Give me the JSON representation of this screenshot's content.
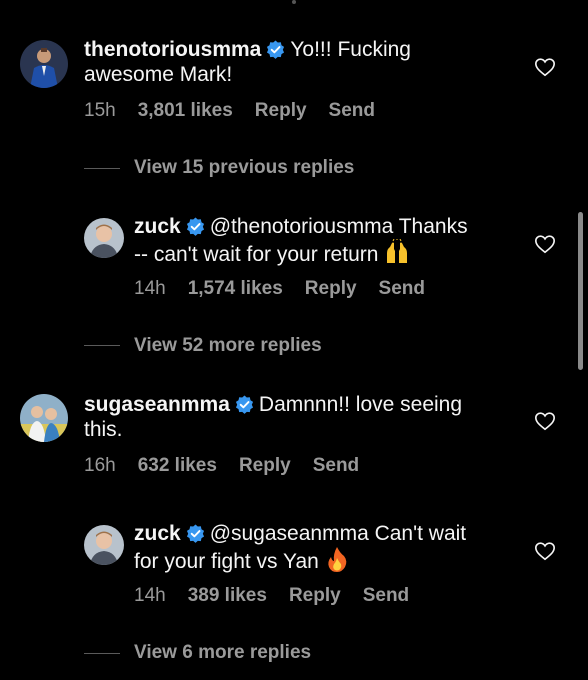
{
  "comments": [
    {
      "username": "thenotoriousmma",
      "text": "Yo!!! Fucking",
      "text2": "awesome Mark!",
      "time": "15h",
      "likes": "3,801 likes",
      "reply": "Reply",
      "send": "Send"
    },
    {
      "username": "zuck",
      "text": "@thenotoriousmma Thanks",
      "text2": "-- can't wait for your return",
      "time": "14h",
      "likes": "1,574 likes",
      "reply": "Reply",
      "send": "Send",
      "emoji": "raising-hands-emoji"
    },
    {
      "username": "sugaseanmma",
      "text": "Damnnn!! love seeing",
      "text2": "this.",
      "time": "16h",
      "likes": "632 likes",
      "reply": "Reply",
      "send": "Send"
    },
    {
      "username": "zuck",
      "text": "@sugaseanmma Can't wait",
      "text2": "for your fight vs Yan",
      "time": "14h",
      "likes": "389 likes",
      "reply": "Reply",
      "send": "Send",
      "emoji": "fire-emoji"
    }
  ],
  "view_links": [
    "View 15 previous replies",
    "View 52 more replies",
    "View 6 more replies"
  ],
  "colors": {
    "background": "#000000",
    "text": "#f5f5f5",
    "secondary": "#9a9a9a",
    "verified": "#3897f0"
  }
}
